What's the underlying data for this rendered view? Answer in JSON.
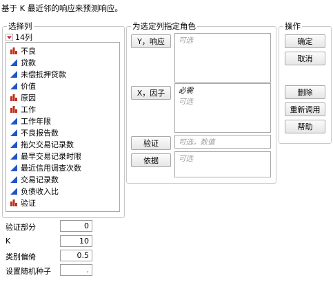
{
  "description": "基于 K 最近邻的响应来预测响应。",
  "select_columns": {
    "legend": "选择列",
    "count_label": "14列",
    "columns": [
      {
        "name": "不良",
        "type": "nominal",
        "icon": "nominal-bar-icon"
      },
      {
        "name": "贷款",
        "type": "continuous",
        "icon": "continuous-triangle-icon"
      },
      {
        "name": "未偿抵押贷款",
        "type": "continuous",
        "icon": "continuous-triangle-icon"
      },
      {
        "name": "价值",
        "type": "continuous",
        "icon": "continuous-triangle-icon"
      },
      {
        "name": "原因",
        "type": "nominal",
        "icon": "nominal-bar-icon"
      },
      {
        "name": "工作",
        "type": "nominal",
        "icon": "nominal-bar-icon"
      },
      {
        "name": "工作年限",
        "type": "continuous",
        "icon": "continuous-triangle-icon"
      },
      {
        "name": "不良报告数",
        "type": "continuous",
        "icon": "continuous-triangle-icon"
      },
      {
        "name": "拖欠交易记录数",
        "type": "continuous",
        "icon": "continuous-triangle-icon"
      },
      {
        "name": "最早交易记录时限",
        "type": "continuous",
        "icon": "continuous-triangle-icon"
      },
      {
        "name": "最近信用调查次数",
        "type": "continuous",
        "icon": "continuous-triangle-icon"
      },
      {
        "name": "交易记录数",
        "type": "continuous",
        "icon": "continuous-triangle-icon"
      },
      {
        "name": "负债收入比",
        "type": "continuous",
        "icon": "continuous-triangle-icon"
      },
      {
        "name": "验证",
        "type": "nominal",
        "icon": "nominal-bar-icon"
      }
    ]
  },
  "cast_roles": {
    "legend": "为选定列指定角色",
    "y_button": "Y，响应",
    "y_placeholder": "可选",
    "x_button": "X，因子",
    "x_required": "必需",
    "x_placeholder": "可选",
    "validation_button": "验证",
    "validation_placeholder": "可选，数值",
    "by_button": "依据",
    "by_placeholder": "可选"
  },
  "actions": {
    "legend": "操作",
    "ok": "确定",
    "cancel": "取消",
    "remove": "删除",
    "recall": "重新调用",
    "help": "帮助"
  },
  "options": {
    "validation_portion_label": "验证部分",
    "validation_portion_value": "0",
    "k_label": "K",
    "k_value": "10",
    "category_bias_label": "类别偏倚",
    "category_bias_value": "0.5",
    "random_seed_label": "设置随机种子",
    "random_seed_value": "."
  },
  "colors": {
    "continuous_icon": "#2255c4",
    "nominal_icon": "#c0301c",
    "disclosure_icon": "#d0202a"
  }
}
